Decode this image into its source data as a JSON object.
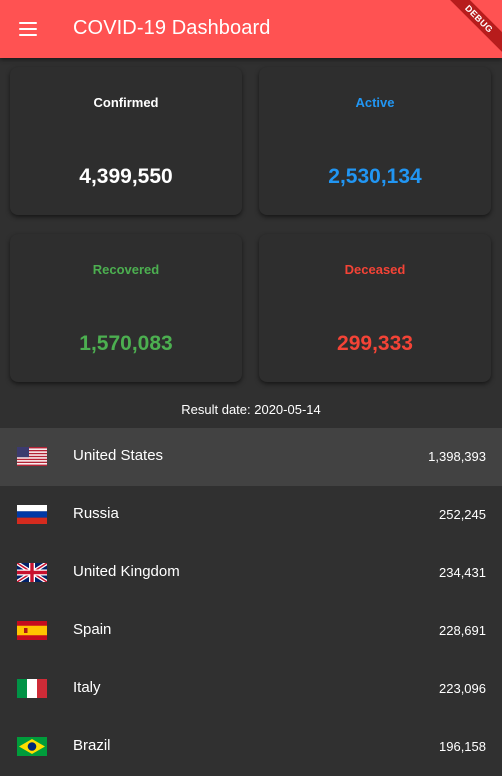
{
  "app_bar": {
    "title": "COVID-19 Dashboard",
    "debug_label": "DEBUG",
    "color": "#ff5252"
  },
  "cards": [
    {
      "label": "Confirmed",
      "value": "4,399,550",
      "color": "#ffffff"
    },
    {
      "label": "Active",
      "value": "2,530,134",
      "color": "#2196f3"
    },
    {
      "label": "Recovered",
      "value": "1,570,083",
      "color": "#4caf50"
    },
    {
      "label": "Deceased",
      "value": "299,333",
      "color": "#f44336"
    }
  ],
  "result_date": "Result date: 2020-05-14",
  "countries": [
    {
      "name": "United States",
      "count": "1,398,393",
      "flag": "us-flag-icon"
    },
    {
      "name": "Russia",
      "count": "252,245",
      "flag": "russia-flag-icon"
    },
    {
      "name": "United Kingdom",
      "count": "234,431",
      "flag": "uk-flag-icon"
    },
    {
      "name": "Spain",
      "count": "228,691",
      "flag": "spain-flag-icon"
    },
    {
      "name": "Italy",
      "count": "223,096",
      "flag": "italy-flag-icon"
    },
    {
      "name": "Brazil",
      "count": "196,158",
      "flag": "brazil-flag-icon"
    }
  ]
}
